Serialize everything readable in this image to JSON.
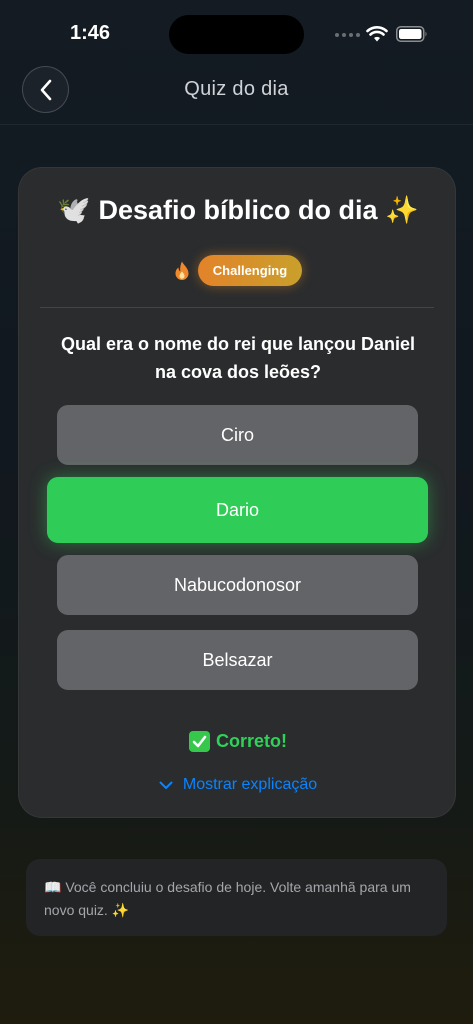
{
  "status_bar": {
    "time": "1:46"
  },
  "nav": {
    "title": "Quiz do dia"
  },
  "card": {
    "title": "🕊️ Desafio bíblico do dia ✨",
    "difficulty": "Challenging",
    "question": "Qual era o nome do rei que lançou Daniel na cova dos leões?",
    "answers": [
      {
        "label": "Ciro",
        "state": "neutral"
      },
      {
        "label": "Dario",
        "state": "correct"
      },
      {
        "label": "Nabucodonosor",
        "state": "neutral"
      },
      {
        "label": "Belsazar",
        "state": "neutral"
      }
    ],
    "result": "Correto!",
    "explanation_link": "Mostrar explicação"
  },
  "footer": {
    "message": "📖 Você concluiu o desafio de hoje. Volte amanhã para um novo quiz. ✨"
  },
  "colors": {
    "correct": "#2fcd57",
    "neutral_answer": "#636467",
    "link": "#0a84ff",
    "badge_start": "#e3832a",
    "badge_end": "#c9a02b"
  },
  "icons": [
    "wifi-icon",
    "battery-icon",
    "back-chevron-icon",
    "fire-icon",
    "checkmark-icon",
    "chevron-down-icon"
  ]
}
